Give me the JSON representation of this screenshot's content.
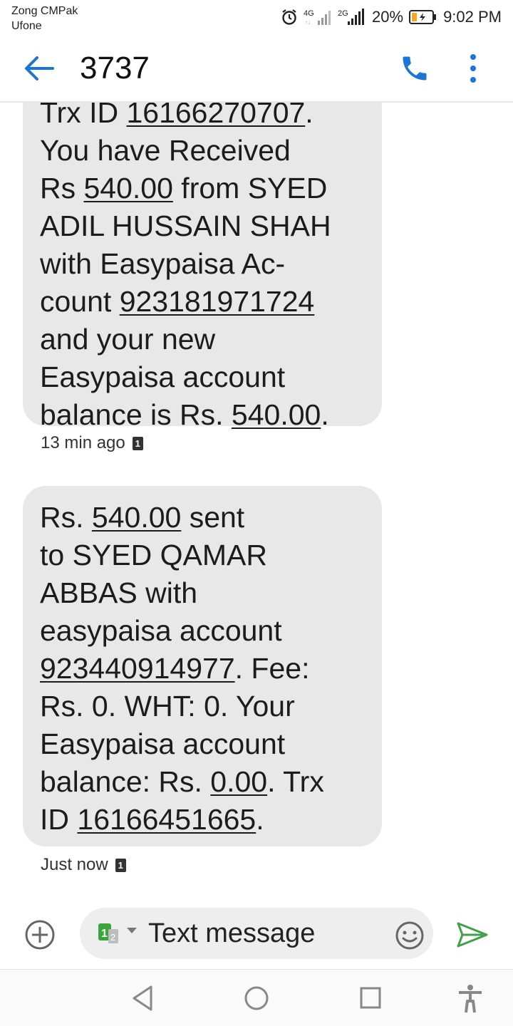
{
  "status_bar": {
    "carrier_1": "Zong CMPak",
    "carrier_2": "Ufone",
    "net_1": "4G",
    "net_2": "2G",
    "battery": "20%",
    "time": "9:02 PM"
  },
  "header": {
    "title": "3737"
  },
  "messages": [
    {
      "lines": [
        [
          "Trx ID ",
          "16166270707",
          "."
        ],
        [
          "You have Received"
        ],
        [
          "Rs ",
          "540.00",
          " from SYED"
        ],
        [
          "ADIL HUSSAIN SHAH"
        ],
        [
          "with Easypaisa Ac-"
        ],
        [
          "count ",
          "923181971724"
        ],
        [
          "and your new"
        ],
        [
          "Easypaisa account"
        ],
        [
          "balance is Rs. ",
          "540.00",
          "."
        ]
      ],
      "time": "13 min ago",
      "sim": "1"
    },
    {
      "lines": [
        [
          "Rs. ",
          "540.00",
          " sent"
        ],
        [
          "to SYED QAMAR"
        ],
        [
          "ABBAS with"
        ],
        [
          "easypaisa account"
        ],
        [
          "",
          "923440914977",
          ". Fee:"
        ],
        [
          "Rs. 0. WHT: 0. Your"
        ],
        [
          "Easypaisa account"
        ],
        [
          "balance: Rs. ",
          "0.00",
          ". Trx"
        ],
        [
          "ID ",
          "16166451665",
          "."
        ]
      ],
      "time": "Just now",
      "sim": "1"
    }
  ],
  "composer": {
    "placeholder": "Text message",
    "sim_primary": "1",
    "sim_secondary": "2"
  },
  "colors": {
    "accent": "#1976d2",
    "send": "#43a047",
    "bubble": "#e8e8e8",
    "sim_green": "#3aa63a"
  },
  "icons": {
    "back": "arrow-left-icon",
    "call": "phone-icon",
    "more": "more-vert-icon",
    "add": "add-circle-icon",
    "emoji": "smiley-icon",
    "send": "send-icon"
  }
}
